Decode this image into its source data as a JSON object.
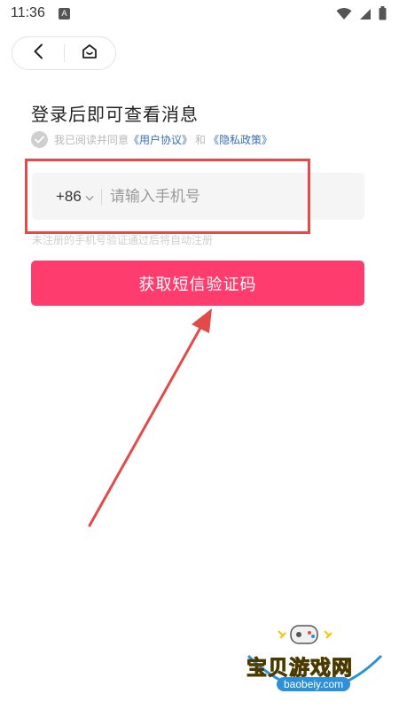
{
  "status_bar": {
    "time": "11:36",
    "app_icon_letter": "A",
    "icons": [
      "wifi-icon",
      "signal-icon",
      "battery-icon"
    ]
  },
  "nav": {
    "back_icon": "chevron-left-icon",
    "home_icon": "home-icon"
  },
  "login": {
    "title": "登录后即可查看消息",
    "agreement_prefix": "我已阅读并同意",
    "user_agreement": "《用户协议》",
    "agreement_and": "和",
    "privacy_policy": "《隐私政策》",
    "country_code": "+86",
    "phone_placeholder": "请输入手机号",
    "hint": "未注册的手机号验证通过后将自动注册",
    "submit_label": "获取短信验证码"
  },
  "colors": {
    "primary": "#fe3d6e",
    "link": "#3a6fb0",
    "annotation": "#e34a4a"
  },
  "watermark": {
    "name": "宝贝游戏网",
    "url": "baobeiy.com"
  }
}
